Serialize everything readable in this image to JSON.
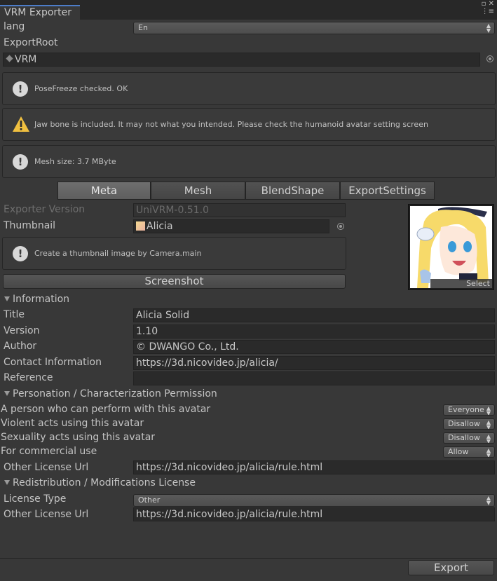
{
  "window": {
    "tab_title": "VRM Exporter"
  },
  "lang": {
    "label": "lang",
    "value": "En"
  },
  "export_root": {
    "label": "ExportRoot",
    "value": "VRM"
  },
  "messages": [
    {
      "type": "info",
      "text": "PoseFreeze checked. OK"
    },
    {
      "type": "warning",
      "text": "Jaw bone is included. It may not what you intended. Please check the humanoid avatar setting screen"
    },
    {
      "type": "info",
      "text": "Mesh size: 3.7 MByte"
    }
  ],
  "tabs": [
    "Meta",
    "Mesh",
    "BlendShape",
    "ExportSettings"
  ],
  "meta": {
    "exporter_version": {
      "label": "Exporter Version",
      "value": "UniVRM-0.51.0"
    },
    "thumbnail": {
      "label": "Thumbnail",
      "value": "Alicia"
    },
    "thumbnail_help": "Create a thumbnail image by Camera.main",
    "screenshot_button": "Screenshot",
    "preview_select": "Select"
  },
  "information": {
    "header": "Information",
    "title": {
      "label": "Title",
      "value": "Alicia Solid"
    },
    "version": {
      "label": "Version",
      "value": "1.10"
    },
    "author": {
      "label": "Author",
      "value": "© DWANGO Co., Ltd."
    },
    "contact": {
      "label": "Contact Information",
      "value": "https://3d.nicovideo.jp/alicia/"
    },
    "reference": {
      "label": "Reference",
      "value": ""
    }
  },
  "persona": {
    "header": "Personation / Characterization Permission",
    "perform": {
      "label": "A person who can perform with this avatar",
      "value": "Everyone"
    },
    "violent": {
      "label": "Violent acts using this avatar",
      "value": "Disallow"
    },
    "sexual": {
      "label": "Sexuality acts using this avatar",
      "value": "Disallow"
    },
    "commercial": {
      "label": "For commercial use",
      "value": "Allow"
    },
    "other_license": {
      "label": "Other License Url",
      "value": "https://3d.nicovideo.jp/alicia/rule.html"
    }
  },
  "redistribution": {
    "header": "Redistribution / Modifications License",
    "license_type": {
      "label": "License Type",
      "value": "Other"
    },
    "other_license": {
      "label": "Other License Url",
      "value": "https://3d.nicovideo.jp/alicia/rule.html"
    }
  },
  "export_button": "Export",
  "colors": {
    "tab_accent": "#4d7dc9",
    "warning": "#f0c040",
    "background": "#383838"
  }
}
